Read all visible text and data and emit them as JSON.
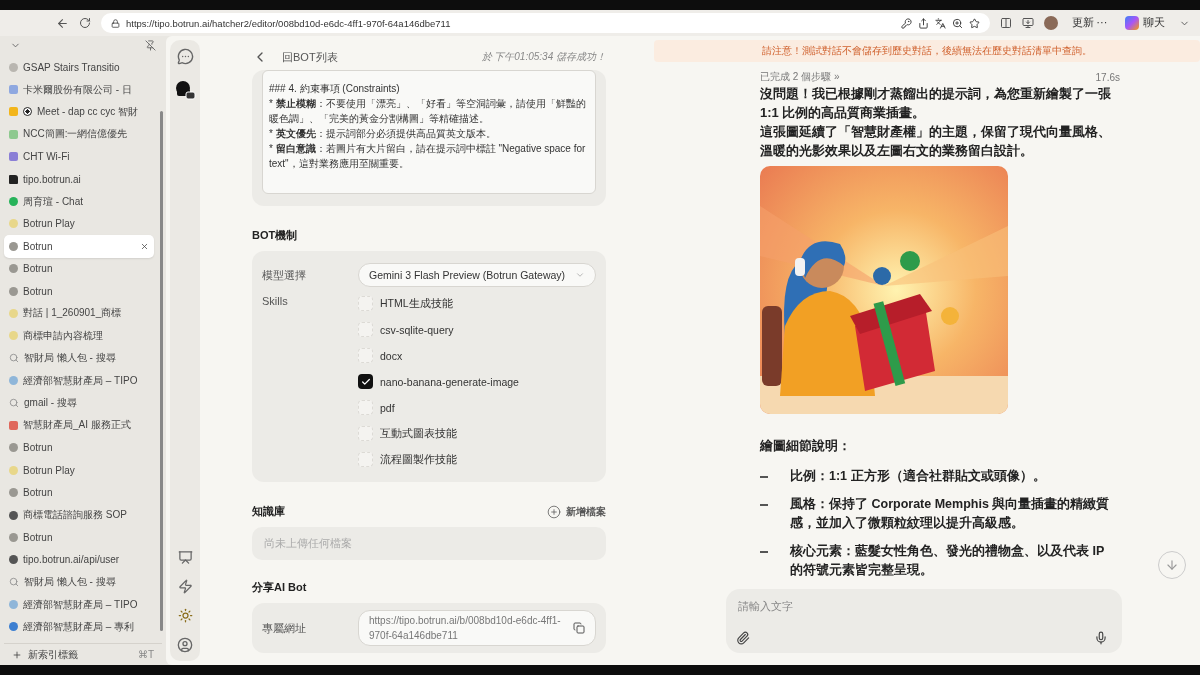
{
  "browser": {
    "url": "https://tipo.botrun.ai/hatcher2/editor/008bd10d-e6dc-4ff1-970f-64a146dbe711",
    "update_label": "更新 ⋯",
    "chat_label": "聊天"
  },
  "tabs": [
    {
      "title": "GSAP Stairs Transitio",
      "kind": "circle",
      "color": "#b9b6b0",
      "recording": false,
      "selected": false
    },
    {
      "title": "卡米爾股份有限公司 - 日",
      "kind": "square",
      "color": "#8fa8e0",
      "recording": false,
      "selected": false
    },
    {
      "title": "Meet - dap cc cyc 智財",
      "kind": "square",
      "color": "#f2b51b",
      "recording": true,
      "selected": false
    },
    {
      "title": "NCC簡圖:一網信億優先",
      "kind": "square",
      "color": "#8ec98f",
      "recording": false,
      "selected": false
    },
    {
      "title": "CHT Wi-Fi",
      "kind": "square",
      "color": "#8b7fd6",
      "recording": false,
      "selected": false
    },
    {
      "title": "tipo.botrun.ai",
      "kind": "page",
      "color": "#222222",
      "recording": false,
      "selected": false
    },
    {
      "title": "周育瑄 - Chat",
      "kind": "circle",
      "color": "#27b35a",
      "recording": false,
      "selected": false
    },
    {
      "title": "Botrun Play",
      "kind": "circle",
      "color": "#e8d78a",
      "recording": false,
      "selected": false
    },
    {
      "title": "Botrun",
      "kind": "circle",
      "color": "#9a9892",
      "recording": false,
      "selected": true
    },
    {
      "title": "Botrun",
      "kind": "circle",
      "color": "#9a9892",
      "recording": false,
      "selected": false
    },
    {
      "title": "Botrun",
      "kind": "circle",
      "color": "#9a9892",
      "recording": false,
      "selected": false
    },
    {
      "title": "對話 | 1_260901_商標",
      "kind": "circle",
      "color": "#e8d78a",
      "recording": false,
      "selected": false
    },
    {
      "title": "商標申請內容梳理",
      "kind": "circle",
      "color": "#e8d78a",
      "recording": false,
      "selected": false
    },
    {
      "title": "智財局 懶人包 - 搜尋",
      "kind": "search",
      "recording": false,
      "selected": false
    },
    {
      "title": "經濟部智慧財產局 – TIPO",
      "kind": "circle",
      "color": "#8fb6d9",
      "recording": false,
      "selected": false
    },
    {
      "title": "gmail - 搜尋",
      "kind": "search",
      "recording": false,
      "selected": false
    },
    {
      "title": "智慧財產局_AI 服務正式",
      "kind": "square",
      "color": "#e0685c",
      "recording": false,
      "selected": false
    },
    {
      "title": "Botrun",
      "kind": "circle",
      "color": "#9a9892",
      "recording": false,
      "selected": false
    },
    {
      "title": "Botrun Play",
      "kind": "circle",
      "color": "#e8d78a",
      "recording": false,
      "selected": false
    },
    {
      "title": "Botrun",
      "kind": "circle",
      "color": "#9a9892",
      "recording": false,
      "selected": false
    },
    {
      "title": "商標電話諮詢服務 SOP",
      "kind": "circle",
      "color": "#555555",
      "recording": false,
      "selected": false
    },
    {
      "title": "Botrun",
      "kind": "circle",
      "color": "#9a9892",
      "recording": false,
      "selected": false
    },
    {
      "title": "tipo.botrun.ai/api/user",
      "kind": "circle",
      "color": "#555555",
      "recording": false,
      "selected": false
    },
    {
      "title": "智財局 懶人包 - 搜尋",
      "kind": "search",
      "recording": false,
      "selected": false
    },
    {
      "title": "經濟部智慧財產局 – TIPO",
      "kind": "circle",
      "color": "#8fb6d9",
      "recording": false,
      "selected": false
    },
    {
      "title": "經濟部智慧財產局 – 專利",
      "kind": "circle",
      "color": "#3d7fd1",
      "recording": false,
      "selected": false
    }
  ],
  "new_tab": {
    "label": "新索引標籤",
    "shortcut": "⌘T"
  },
  "editor": {
    "back_label": "回BOT列表",
    "save_status": "於 下午01:05:34 儲存成功！",
    "prompt_lines": [
      "### 4. 約束事項 (Constraints)",
      "*   **禁止模糊**：不要使用「漂亮」、「好看」等空洞詞彙，請使用「鮮豔的暖色調」、「完美的黃金分割構圖」等精確描述。",
      "*   **英文優先**：提示詞部分必須提供高品質英文版本。",
      "*   **留白意識**：若圖片有大片留白，請在提示詞中標註 \"Negative space for text\"，這對業務應用至關重要。"
    ],
    "mechanism_title": "BOT機制",
    "model_label": "模型選擇",
    "model_value": "Gemini 3 Flash Preview (Botrun Gateway)",
    "skills_label": "Skills",
    "skills": [
      {
        "label": "HTML生成技能",
        "checked": false
      },
      {
        "label": "csv-sqlite-query",
        "checked": false
      },
      {
        "label": "docx",
        "checked": false
      },
      {
        "label": "nano-banana-generate-image",
        "checked": true
      },
      {
        "label": "pdf",
        "checked": false
      },
      {
        "label": "互動式圖表技能",
        "checked": false
      },
      {
        "label": "流程圖製作技能",
        "checked": false
      }
    ],
    "knowledge_title": "知識庫",
    "add_file_label": "新增檔案",
    "knowledge_empty": "尚未上傳任何檔案",
    "share_title": "分享AI Bot",
    "share_url_label": "專屬網址",
    "share_url": "https://tipo.botrun.ai/b/008bd10d-e6dc-4ff1-970f-64a146dbe711"
  },
  "chat": {
    "notice": "請注意！測試對話不會儲存到歷史對話，後續無法在歷史對話清單中查詢。",
    "steps": "已完成 2 個步驟 »",
    "duration": "17.6s",
    "paragraphs": [
      "沒問題！我已根據剛才蒸餾出的提示詞，為您重新繪製了一張 1:1 比例的高品質商業插畫。",
      "這張圖延續了「智慧財產權」的主題，保留了現代向量風格、溫暖的光影效果以及左圖右文的業務留白設計。"
    ],
    "image": {
      "kind": "picture"
    },
    "details_title": "繪圖細節說明：",
    "bullets": [
      "比例：1:1 正方形（適合社群貼文或頭像）。",
      "風格：保持了 Corporate Memphis 與向量插畫的精緻質感，並加入了微顆粒紋理以提升高級感。",
      "核心元素：藍髮女性角色、發光的禮物盒、以及代表 IP 的符號元素皆完整呈現。"
    ],
    "input_placeholder": "請輸入文字"
  }
}
